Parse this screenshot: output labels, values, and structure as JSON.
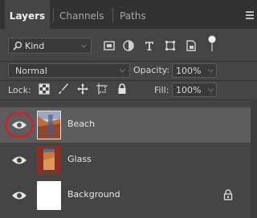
{
  "tabs": [
    {
      "label": "Layers",
      "active": true
    },
    {
      "label": "Channels",
      "active": false
    },
    {
      "label": "Paths",
      "active": false
    }
  ],
  "filter": {
    "kind_label": "Kind"
  },
  "blend": {
    "mode": "Normal",
    "opacity_label": "Opacity:",
    "opacity_value": "100%"
  },
  "lock": {
    "label": "Lock:",
    "fill_label": "Fill:",
    "fill_value": "100%"
  },
  "layers": [
    {
      "name": "Beach",
      "selected": true,
      "visible": true,
      "locked": false
    },
    {
      "name": "Glass",
      "selected": false,
      "visible": true,
      "locked": false
    },
    {
      "name": "Background",
      "selected": false,
      "visible": true,
      "locked": true
    }
  ],
  "colors": {
    "highlight_circle": "#d0202a"
  }
}
